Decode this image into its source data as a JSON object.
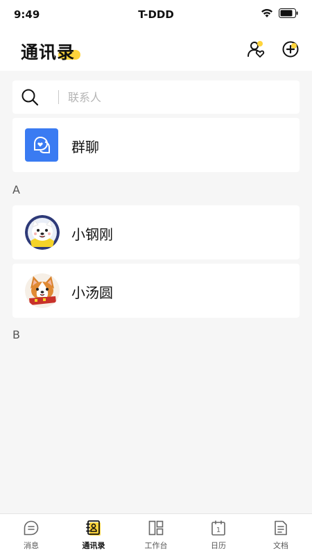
{
  "status_bar": {
    "time": "9:49",
    "carrier": "T-DDD",
    "icons": [
      "wifi-icon",
      "battery-icon"
    ]
  },
  "header": {
    "title": "通讯录",
    "accent_color": "#ffd43b",
    "actions": [
      "contact-heart-icon",
      "plus-circle-icon"
    ]
  },
  "search": {
    "placeholder": "联系人",
    "value": ""
  },
  "group_chat": {
    "label": "群聊",
    "icon": "chat-bubbles-icon",
    "icon_bg": "#3a7bf2"
  },
  "sections": [
    {
      "letter": "A",
      "contacts": [
        {
          "name": "小钢刚",
          "avatar": "samoyed-dog-avatar"
        },
        {
          "name": "小汤圆",
          "avatar": "corgi-dog-avatar"
        }
      ]
    },
    {
      "letter": "B",
      "contacts": []
    }
  ],
  "tab_bar": {
    "active": "通讯录",
    "items": [
      {
        "label": "消息",
        "icon": "message-icon"
      },
      {
        "label": "通讯录",
        "icon": "contacts-book-icon"
      },
      {
        "label": "工作台",
        "icon": "workbench-icon"
      },
      {
        "label": "日历",
        "icon": "calendar-icon",
        "day": "1"
      },
      {
        "label": "文档",
        "icon": "document-icon"
      }
    ]
  }
}
